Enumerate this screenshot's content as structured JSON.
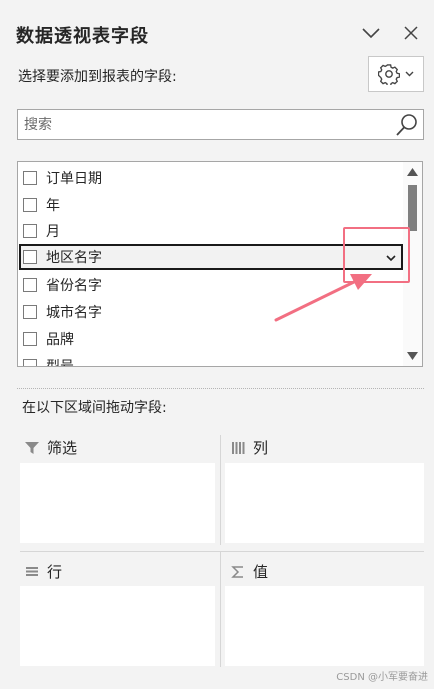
{
  "panel": {
    "title": "数据透视表字段",
    "subtitle": "选择要添加到报表的字段:",
    "collapse_icon": "chevron-down-icon",
    "close_icon": "close-icon",
    "tools_icon": "gear-icon"
  },
  "search": {
    "placeholder": "搜索",
    "value": ""
  },
  "fields": [
    {
      "label": "订单日期",
      "checked": false
    },
    {
      "label": "年",
      "checked": false
    },
    {
      "label": "月",
      "checked": false
    },
    {
      "label": "地区名字",
      "checked": false,
      "selected": true
    },
    {
      "label": "省份名字",
      "checked": false
    },
    {
      "label": "城市名字",
      "checked": false
    },
    {
      "label": "品牌",
      "checked": false
    },
    {
      "label": "型号",
      "checked": false
    }
  ],
  "areas": {
    "instruction": "在以下区域间拖动字段:",
    "filters": {
      "label": "筛选",
      "icon": "filter-icon"
    },
    "columns": {
      "label": "列",
      "icon": "columns-icon"
    },
    "rows": {
      "label": "行",
      "icon": "rows-icon"
    },
    "values": {
      "label": "值",
      "icon": "sigma-icon"
    }
  },
  "annotation": {
    "color": "#f26f82"
  },
  "watermark": "CSDN @小军要奋进"
}
